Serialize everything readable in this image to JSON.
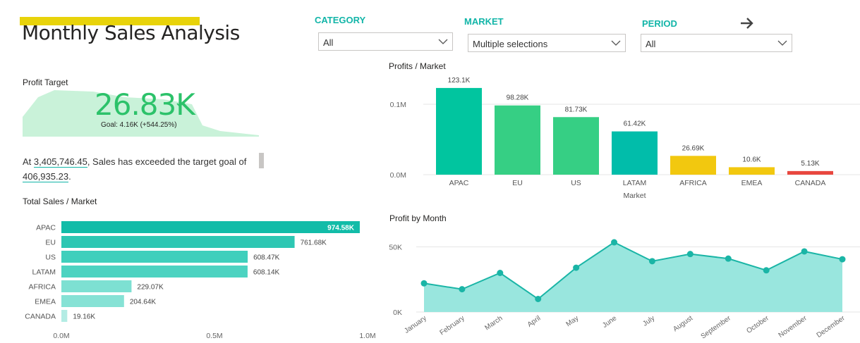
{
  "header": {
    "title": "Monthly Sales Analysis",
    "accent_color": "#e8d30a"
  },
  "filters": {
    "category": {
      "label": "CATEGORY",
      "value": "All"
    },
    "market": {
      "label": "MARKET",
      "value": "Multiple selections"
    },
    "period": {
      "label": "PERIOD",
      "value": "All"
    },
    "label_color": "#12b5a8",
    "next_icon": "arrow-right-icon"
  },
  "kpi": {
    "label": "Profit Target",
    "value": "26.83K",
    "check_icon": "checkmark-icon",
    "goal": "Goal: 4.16K (+544.25%)",
    "color": "#2cc26a"
  },
  "narrative": {
    "prefix": "At ",
    "sales_value": "3,405,746.45",
    "middle": ", Sales has exceeded the target goal of ",
    "target_value": "406,935.23",
    "suffix": "."
  },
  "chart_data": [
    {
      "type": "bar",
      "orientation": "horizontal",
      "title": "Total Sales / Market",
      "categories": [
        "APAC",
        "EU",
        "US",
        "LATAM",
        "AFRICA",
        "EMEA",
        "CANADA"
      ],
      "values": [
        974580,
        761680,
        608470,
        608140,
        229070,
        204640,
        19160
      ],
      "data_labels": [
        "974.58K",
        "761.68K",
        "608.47K",
        "608.14K",
        "229.07K",
        "204.64K",
        "19.16K"
      ],
      "x_ticks": [
        "0.0M",
        "0.5M",
        "1.0M"
      ],
      "xlim": [
        0,
        1000000
      ],
      "colors": [
        "#12bca8",
        "#2ec7b3",
        "#3fcfbc",
        "#4cd3c1",
        "#7de0d2",
        "#86e2d5",
        "#b3ece4"
      ]
    },
    {
      "type": "bar",
      "title": "Profits / Market",
      "xlabel": "Market",
      "categories": [
        "APAC",
        "EU",
        "US",
        "LATAM",
        "AFRICA",
        "EMEA",
        "CANADA"
      ],
      "values": [
        123100,
        98280,
        81730,
        61420,
        26690,
        10600,
        5130
      ],
      "data_labels": [
        "123.1K",
        "98.28K",
        "81.73K",
        "61.42K",
        "26.69K",
        "10.6K",
        "5.13K"
      ],
      "y_ticks": [
        {
          "value": 0,
          "label": "0.0M"
        },
        {
          "value": 100000,
          "label": "0.1M"
        }
      ],
      "ylim": [
        0,
        140000
      ],
      "colors": [
        "#01c59f",
        "#36cf84",
        "#36cf84",
        "#01bdaa",
        "#f2c80f",
        "#f2c80f",
        "#e8473f"
      ]
    },
    {
      "type": "area",
      "title": "Profit by Month",
      "categories": [
        "January",
        "February",
        "March",
        "April",
        "May",
        "June",
        "July",
        "August",
        "September",
        "October",
        "November",
        "December"
      ],
      "values": [
        22000,
        17500,
        30000,
        10000,
        34000,
        53500,
        39000,
        44500,
        41000,
        32000,
        46500,
        40500
      ],
      "y_ticks": [
        {
          "value": 0,
          "label": "0K"
        },
        {
          "value": 50000,
          "label": "50K"
        }
      ],
      "ylim": [
        0,
        60000
      ],
      "line_color": "#1ab5a6",
      "fill_color": "#99e6de"
    }
  ]
}
